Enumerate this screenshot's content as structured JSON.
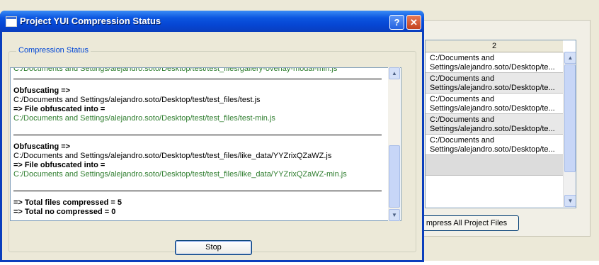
{
  "dialog": {
    "title": "Project YUI Compression Status",
    "help_label": "?",
    "close_label": "✕",
    "group_label": "Compression Status",
    "stop_label": "Stop",
    "log": {
      "top_line": "C:/Documents and Settings/alejandro.soto/Desktop/test/test_files/gallery-overlay-modal-min.js",
      "entries": [
        {
          "obf": "Obfuscating =>",
          "src": "C:/Documents and Settings/alejandro.soto/Desktop/test/test_files/test.js",
          "into": "=> File obfuscated into =",
          "dst": "C:/Documents and Settings/alejandro.soto/Desktop/test/test_files/test-min.js"
        },
        {
          "obf": "Obfuscating =>",
          "src": "C:/Documents and Settings/alejandro.soto/Desktop/test/test_files/like_data/YYZrixQZaWZ.js",
          "into": "=> File obfuscated into =",
          "dst": "C:/Documents and Settings/alejandro.soto/Desktop/test/test_files/like_data/YYZrixQZaWZ-min.js"
        }
      ],
      "total_compressed": "=> Total files compressed = 5",
      "total_no_compressed": "=> Total no compressed = 0"
    }
  },
  "background": {
    "column_header": "2",
    "rows": [
      {
        "line1": "C:/Documents and",
        "line2": "Settings/alejandro.soto/Desktop/te..."
      },
      {
        "line1": "C:/Documents and",
        "line2": "Settings/alejandro.soto/Desktop/te..."
      },
      {
        "line1": "C:/Documents and",
        "line2": "Settings/alejandro.soto/Desktop/te..."
      },
      {
        "line1": "C:/Documents and",
        "line2": "Settings/alejandro.soto/Desktop/te..."
      },
      {
        "line1": "C:/Documents and",
        "line2": "Settings/alejandro.soto/Desktop/te..."
      }
    ],
    "button_label": "mpress All Project Files"
  }
}
